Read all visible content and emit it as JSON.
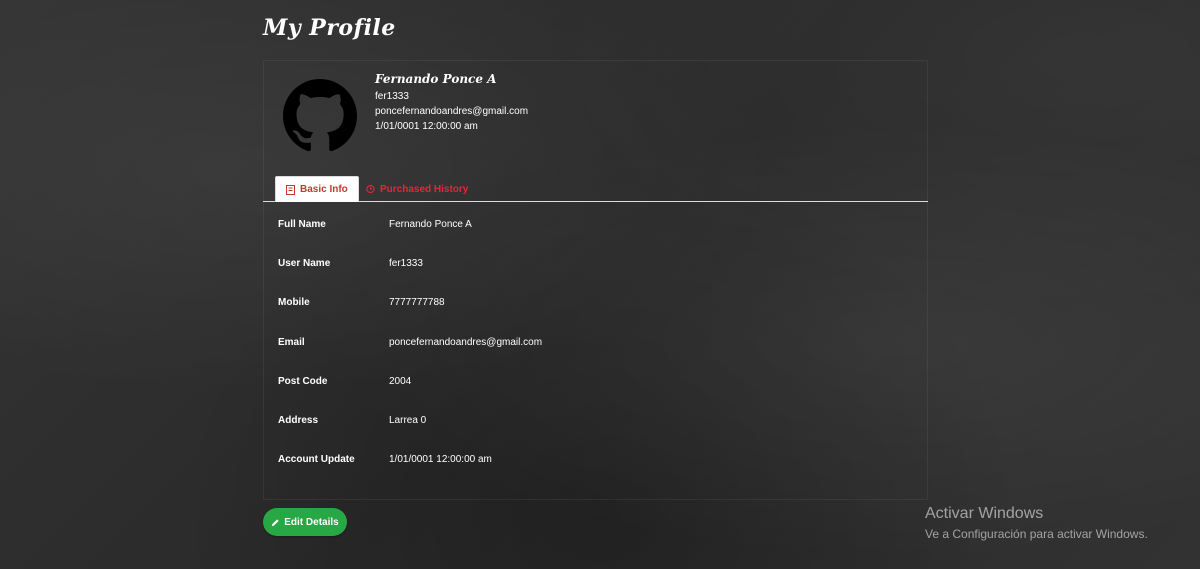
{
  "page": {
    "title": "My Profile"
  },
  "profile": {
    "name": "Fernando Ponce A",
    "username": "fer1333",
    "email": "poncefernandoandres@gmail.com",
    "date": "1/01/0001 12:00:00 am",
    "avatar_icon": "github-icon"
  },
  "tabs": [
    {
      "label": "Basic Info",
      "icon": "document-icon",
      "active": true
    },
    {
      "label": "Purchased History",
      "icon": "clock-icon",
      "active": false
    }
  ],
  "basic_info": [
    {
      "label": "Full Name",
      "value": "Fernando Ponce A"
    },
    {
      "label": "User Name",
      "value": "fer1333"
    },
    {
      "label": "Mobile",
      "value": "7777777788"
    },
    {
      "label": "Email",
      "value": "poncefernandoandres@gmail.com"
    },
    {
      "label": "Post Code",
      "value": "2004"
    },
    {
      "label": "Address",
      "value": "Larrea 0"
    },
    {
      "label": "Account Update",
      "value": "1/01/0001 12:00:00 am"
    }
  ],
  "actions": {
    "edit_label": "Edit Details",
    "edit_icon": "pencil-icon"
  },
  "watermark": {
    "title": "Activar Windows",
    "subtitle": "Ve a Configuración para activar Windows."
  },
  "colors": {
    "accent": "#e0283a",
    "button": "#28a745",
    "background": "#2f2f2f"
  }
}
